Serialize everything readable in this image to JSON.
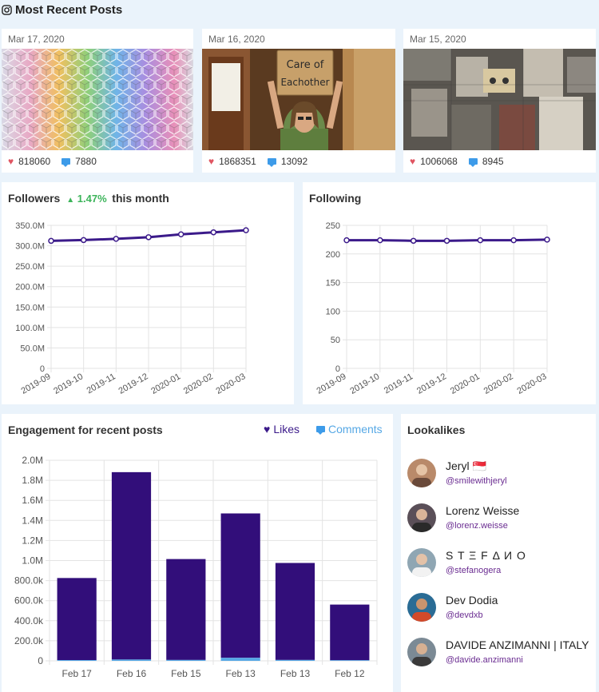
{
  "header": {
    "title": "Most Recent Posts",
    "icon": "instagram-icon"
  },
  "posts": [
    {
      "date": "Mar 17, 2020",
      "likes": "818060",
      "comments": "7880",
      "image": "colorful-cubes-pattern"
    },
    {
      "date": "Mar 16, 2020",
      "likes": "1868351",
      "comments": "13092",
      "image": "man-holding-sign",
      "sign_text": "Care of Eachother"
    },
    {
      "date": "Mar 15, 2020",
      "likes": "1006068",
      "comments": "8945",
      "image": "rooftops-aerial-view"
    }
  ],
  "followers": {
    "title": "Followers",
    "growth": "1.47%",
    "growth_suffix": "this month",
    "chart_data": {
      "type": "line",
      "x": [
        "2019-09",
        "2019-10",
        "2019-11",
        "2019-12",
        "2020-01",
        "2020-02",
        "2020-03"
      ],
      "values": [
        312,
        314,
        317,
        321,
        328,
        333,
        338
      ],
      "y_unit": "M",
      "ylim": [
        0,
        350
      ],
      "yticks": [
        "350.0M",
        "300.0M",
        "250.0M",
        "200.0M",
        "150.0M",
        "100.0M",
        "50.0M",
        "0"
      ],
      "color": "#3b1a8a",
      "grid": true
    }
  },
  "following": {
    "title": "Following",
    "chart_data": {
      "type": "line",
      "x": [
        "2019-09",
        "2019-10",
        "2019-11",
        "2019-12",
        "2020-01",
        "2020-02",
        "2020-03"
      ],
      "values": [
        224,
        224,
        223,
        223,
        224,
        224,
        225
      ],
      "ylim": [
        0,
        250
      ],
      "yticks": [
        "250",
        "200",
        "150",
        "100",
        "50",
        "0"
      ],
      "color": "#3b1a8a",
      "grid": true
    }
  },
  "engagement": {
    "title": "Engagement for recent posts",
    "legend": {
      "likes": "Likes",
      "comments": "Comments"
    },
    "colors": {
      "likes": "#320e7a",
      "comments": "#56a8e5"
    },
    "chart_data": {
      "type": "bar",
      "stacked": true,
      "categories": [
        "Feb 17",
        "Feb 16",
        "Feb 15",
        "Feb 13",
        "Feb 13",
        "Feb 12"
      ],
      "series": [
        {
          "name": "Likes",
          "values": [
            818060,
            1868351,
            1006068,
            1440000,
            967000,
            555000
          ]
        },
        {
          "name": "Comments",
          "values": [
            7880,
            13092,
            8945,
            30000,
            9000,
            6000
          ]
        }
      ],
      "ylim": [
        0,
        2000000
      ],
      "yticks": [
        "2.0M",
        "1.8M",
        "1.6M",
        "1.4M",
        "1.2M",
        "1.0M",
        "800.0k",
        "600.0k",
        "400.0k",
        "200.0k",
        "0"
      ],
      "grid": true
    }
  },
  "lookalikes": {
    "title": "Lookalikes",
    "items": [
      {
        "name": "Jeryl 🇸🇬",
        "handle": "@smilewithjeryl",
        "avatar_color": "#b98a6a"
      },
      {
        "name": "Lorenz Weisse",
        "handle": "@lorenz.weisse",
        "avatar_color": "#5a4f58"
      },
      {
        "name": "S T Ξ F Δ И O",
        "handle": "@stefanogera",
        "avatar_color": "#8fa6b3"
      },
      {
        "name": "Dev Dodia",
        "handle": "@devdxb",
        "avatar_color": "#2a6c95"
      },
      {
        "name": "DAVIDE ANZIMANNI | ITALY",
        "handle": "@davide.anzimanni",
        "avatar_color": "#7b8a95"
      }
    ]
  }
}
